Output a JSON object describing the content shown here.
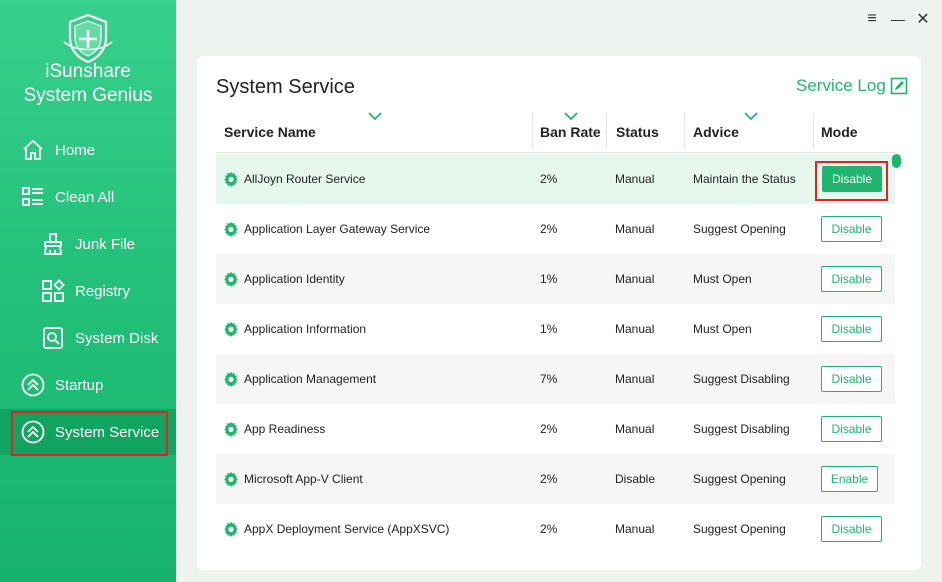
{
  "app": {
    "title_line1": "iSunshare",
    "title_line2": "System Genius"
  },
  "colors": {
    "accent": "#1fb56f",
    "sidebar": "#22c07a",
    "highlight": "#e02424"
  },
  "sidebar": {
    "items": [
      {
        "label": "Home",
        "icon": "home-icon"
      },
      {
        "label": "Clean All",
        "icon": "list-icon"
      },
      {
        "label": "Junk File",
        "icon": "broom-icon"
      },
      {
        "label": "Registry",
        "icon": "grid-icon"
      },
      {
        "label": "System Disk",
        "icon": "disk-icon"
      },
      {
        "label": "Startup",
        "icon": "chevron-up-circle-icon"
      },
      {
        "label": "System Service",
        "icon": "chevron-up-circle-icon"
      }
    ]
  },
  "window": {
    "menu_icon": "≡",
    "minimize_icon": "—",
    "close_icon": "✕"
  },
  "page": {
    "title": "System Service",
    "service_log": "Service Log"
  },
  "table": {
    "columns": [
      "Service Name",
      "Ban Rate",
      "Status",
      "Advice",
      "Mode"
    ],
    "rows": [
      {
        "name": "AllJoyn Router Service",
        "ban_rate": "2%",
        "status": "Manual",
        "advice": "Maintain the Status",
        "mode": "Disable"
      },
      {
        "name": "Application Layer Gateway Service",
        "ban_rate": "2%",
        "status": "Manual",
        "advice": "Suggest Opening",
        "mode": "Disable"
      },
      {
        "name": "Application Identity",
        "ban_rate": "1%",
        "status": "Manual",
        "advice": "Must Open",
        "mode": "Disable"
      },
      {
        "name": "Application Information",
        "ban_rate": "1%",
        "status": "Manual",
        "advice": "Must Open",
        "mode": "Disable"
      },
      {
        "name": "Application Management",
        "ban_rate": "7%",
        "status": "Manual",
        "advice": "Suggest Disabling",
        "mode": "Disable"
      },
      {
        "name": "App Readiness",
        "ban_rate": "2%",
        "status": "Manual",
        "advice": "Suggest Disabling",
        "mode": "Disable"
      },
      {
        "name": "Microsoft App-V Client",
        "ban_rate": "2%",
        "status": "Disable",
        "advice": "Suggest Opening",
        "mode": "Enable"
      },
      {
        "name": "AppX Deployment Service (AppXSVC)",
        "ban_rate": "2%",
        "status": "Manual",
        "advice": "Suggest Opening",
        "mode": "Disable"
      }
    ]
  }
}
